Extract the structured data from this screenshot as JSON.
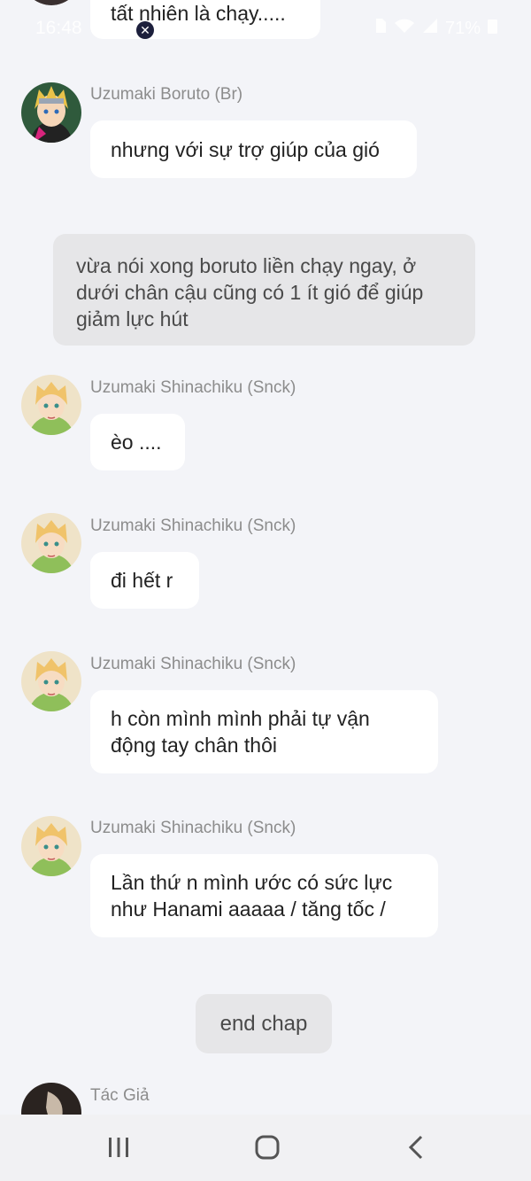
{
  "status_bar": {
    "time": "16:48",
    "battery": "71%",
    "icons": [
      "wifi-icon",
      "signal-icon",
      "battery-icon",
      "sim-icon"
    ]
  },
  "messages": {
    "top_partial": "tất nhiên là chạy.....",
    "m1": {
      "sender": "Uzumaki Boruto (Br)",
      "text": "nhưng với sự trợ giúp của gió"
    },
    "narration": "vừa nói xong boruto liền chạy ngay, ở dưới chân cậu cũng có 1 ít gió để giúp giảm lực hút",
    "m2": {
      "sender": "Uzumaki Shinachiku (Snck)",
      "text": "èo ...."
    },
    "m3": {
      "sender": "Uzumaki Shinachiku (Snck)",
      "text": "đi hết r"
    },
    "m4": {
      "sender": "Uzumaki Shinachiku (Snck)",
      "text": "h còn mình mình phải tự vận động tay chân thôi"
    },
    "m5": {
      "sender": "Uzumaki Shinachiku (Snck)",
      "text": "Lần thứ n mình ước có sức lực như Hanami aaaaa / tăng tốc /"
    },
    "end_chap": "end chap",
    "m6": {
      "sender": "Tác Giả"
    }
  },
  "nav": {
    "buttons": [
      "recent-apps-icon",
      "home-icon",
      "back-icon"
    ]
  },
  "colors": {
    "background": "#f3f4f8",
    "bubble": "#ffffff",
    "narration_bubble": "#e6e6e8",
    "sender_name": "#8c8c8c"
  }
}
